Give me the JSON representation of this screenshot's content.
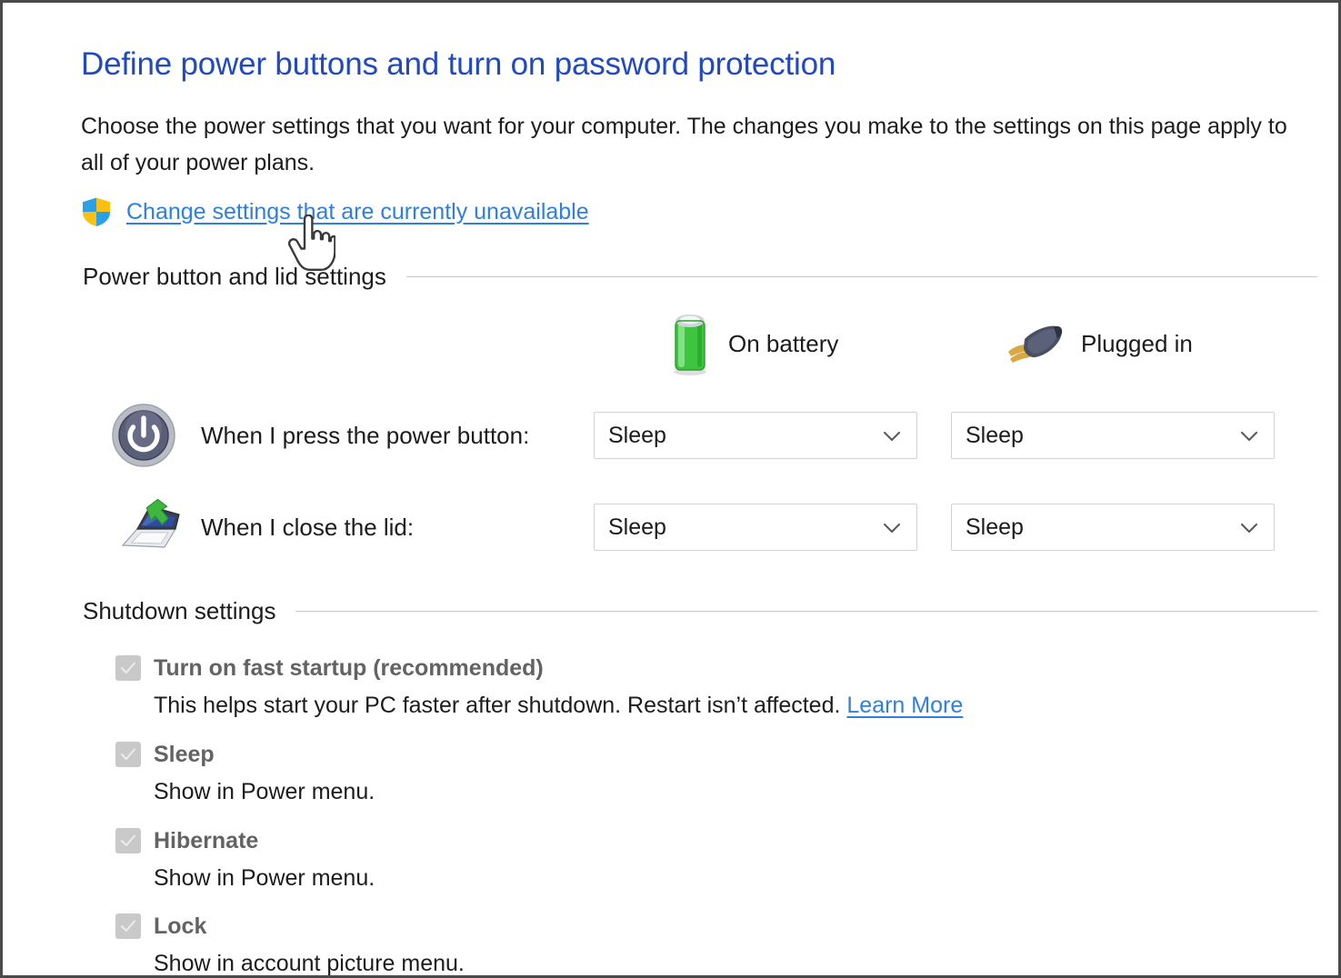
{
  "page": {
    "title": "Define power buttons and turn on password protection",
    "intro": "Choose the power settings that you want for your computer. The changes you make to the settings on this page apply to all of your power plans.",
    "uac_link": "Change settings that are currently unavailable",
    "uac_icon": "shield-icon",
    "cursor_icon": "hand-pointer-cursor",
    "accent_link_color": "#2f7fe0",
    "title_color": "#2149c0"
  },
  "power_section": {
    "heading": "Power button and lid settings",
    "columns": [
      {
        "label": "On battery",
        "icon": "battery-icon"
      },
      {
        "label": "Plugged in",
        "icon": "power-plug-icon"
      }
    ],
    "rows": [
      {
        "icon": "power-button-icon",
        "label": "When I press the power button:",
        "on_battery": "Sleep",
        "plugged_in": "Sleep"
      },
      {
        "icon": "laptop-close-lid-icon",
        "label": "When I close the lid:",
        "on_battery": "Sleep",
        "plugged_in": "Sleep"
      }
    ]
  },
  "shutdown_section": {
    "heading": "Shutdown settings",
    "items": [
      {
        "label": "Turn on fast startup (recommended)",
        "checked": true,
        "disabled": true,
        "desc_before": "This helps start your PC faster after shutdown. Restart isn’t affected. ",
        "desc_link": "Learn More"
      },
      {
        "label": "Sleep",
        "checked": true,
        "disabled": true,
        "desc_before": "Show in Power menu.",
        "desc_link": ""
      },
      {
        "label": "Hibernate",
        "checked": true,
        "disabled": true,
        "desc_before": "Show in Power menu.",
        "desc_link": ""
      },
      {
        "label": "Lock",
        "checked": true,
        "disabled": true,
        "desc_before": "Show in account picture menu.",
        "desc_link": ""
      }
    ]
  }
}
